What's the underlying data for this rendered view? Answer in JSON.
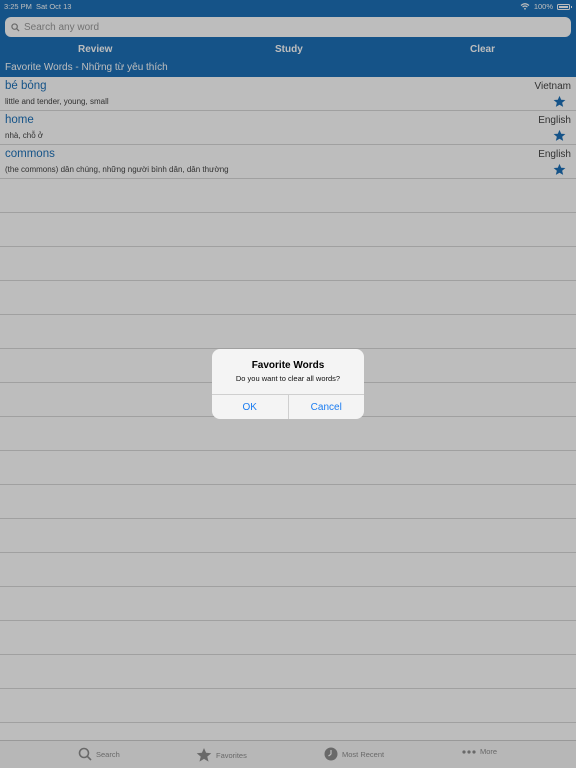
{
  "status": {
    "time": "3:25 PM",
    "date": "Sat Oct 13",
    "battery": "100%"
  },
  "search": {
    "placeholder": "Search any word"
  },
  "tabs": {
    "review": "Review",
    "study": "Study",
    "clear": "Clear"
  },
  "section_title": "Favorite Words - Những từ yêu thích",
  "words": [
    {
      "word": "bé bỏng",
      "lang": "Vietnam",
      "definition": "little and tender, young, small"
    },
    {
      "word": "home",
      "lang": "English",
      "definition": "nhà, chỗ ở"
    },
    {
      "word": "commons",
      "lang": "English",
      "definition": "(the commons) dân chúng, những người bình dân, dân thường"
    }
  ],
  "tabbar": {
    "search": "Search",
    "favorites": "Favorites",
    "recent": "Most Recent",
    "more": "More"
  },
  "alert": {
    "title": "Favorite Words",
    "message": "Do you want to clear all words?",
    "ok": "OK",
    "cancel": "Cancel"
  },
  "colors": {
    "accent": "#1d71b8",
    "alert_button": "#1a7cf1"
  }
}
